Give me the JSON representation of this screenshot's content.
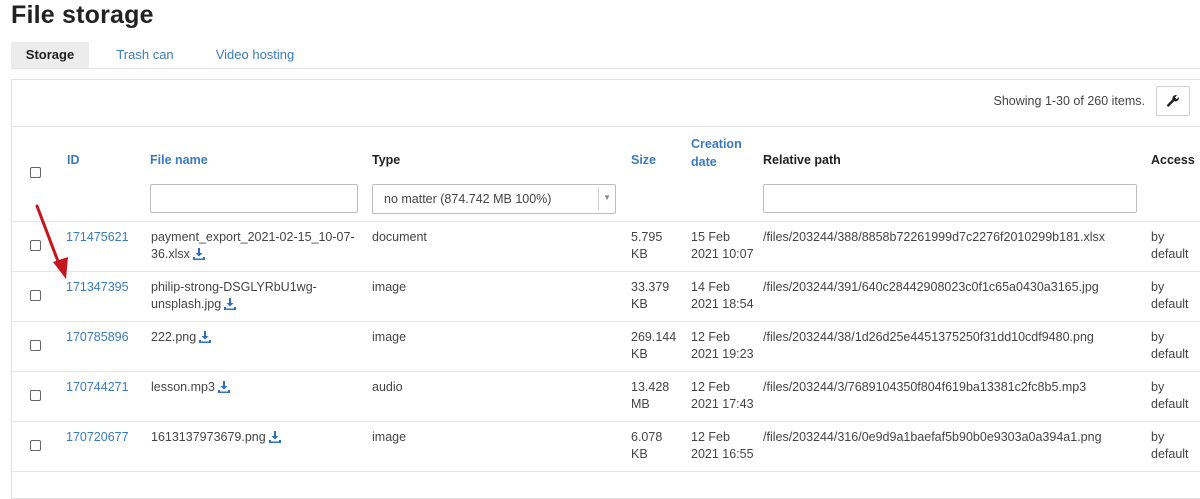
{
  "page": {
    "title": "File storage"
  },
  "tabs": [
    {
      "label": "Storage",
      "active": true
    },
    {
      "label": "Trash can",
      "active": false
    },
    {
      "label": "Video hosting",
      "active": false
    }
  ],
  "summary": "Showing 1-30 of 260 items.",
  "columns": {
    "id": "ID",
    "file_name": "File name",
    "type": "Type",
    "size": "Size",
    "creation_date": "Creation date",
    "relative_path": "Relative path",
    "access": "Access"
  },
  "filters": {
    "file_name": "",
    "type_selected": "no matter (874.742 MB 100%)",
    "relative_path": ""
  },
  "rows": [
    {
      "id": "171475621",
      "name": [
        "payment_export_2021-02-15_10-07-",
        "36.xlsx"
      ],
      "type": "document",
      "size": [
        "5.795",
        "KB"
      ],
      "date": [
        "15 Feb",
        "2021 10:07"
      ],
      "path": "/files/203244/388/8858b72261999d7c2276f2010299b181.xlsx",
      "access": [
        "by",
        "default"
      ]
    },
    {
      "id": "171347395",
      "name": [
        "philip-strong-DSGLYRbU1wg-",
        "unsplash.jpg"
      ],
      "type": "image",
      "size": [
        "33.379",
        "KB"
      ],
      "date": [
        "14 Feb",
        "2021 18:54"
      ],
      "path": "/files/203244/391/640c28442908023c0f1c65a0430a3165.jpg",
      "access": [
        "by",
        "default"
      ]
    },
    {
      "id": "170785896",
      "name": [
        "222.png",
        ""
      ],
      "type": "image",
      "size": [
        "269.144",
        "KB"
      ],
      "date": [
        "12 Feb",
        "2021 19:23"
      ],
      "path": "/files/203244/38/1d26d25e4451375250f31dd10cdf9480.png",
      "access": [
        "by",
        "default"
      ]
    },
    {
      "id": "170744271",
      "name": [
        "lesson.mp3",
        ""
      ],
      "type": "audio",
      "size": [
        "13.428",
        "MB"
      ],
      "date": [
        "12 Feb",
        "2021 17:43"
      ],
      "path": "/files/203244/3/7689104350f804f619ba13381c2fc8b5.mp3",
      "access": [
        "by",
        "default"
      ]
    },
    {
      "id": "170720677",
      "name": [
        "1613137973679.png",
        ""
      ],
      "type": "image",
      "size": [
        "6.078",
        "KB"
      ],
      "date": [
        "12 Feb",
        "2021 16:55"
      ],
      "path": "/files/203244/316/0e9d9a1baefaf5b90b0e9303a0a394a1.png",
      "access": [
        "by",
        "default"
      ]
    }
  ],
  "colors": {
    "link": "#3a7bbf",
    "annotation_arrow": "#c4161c",
    "download_icon": "#2f6fb5"
  },
  "icons": {
    "settings": "wrench-icon",
    "download": "download-icon",
    "select_arrow": "caret-down-icon"
  }
}
